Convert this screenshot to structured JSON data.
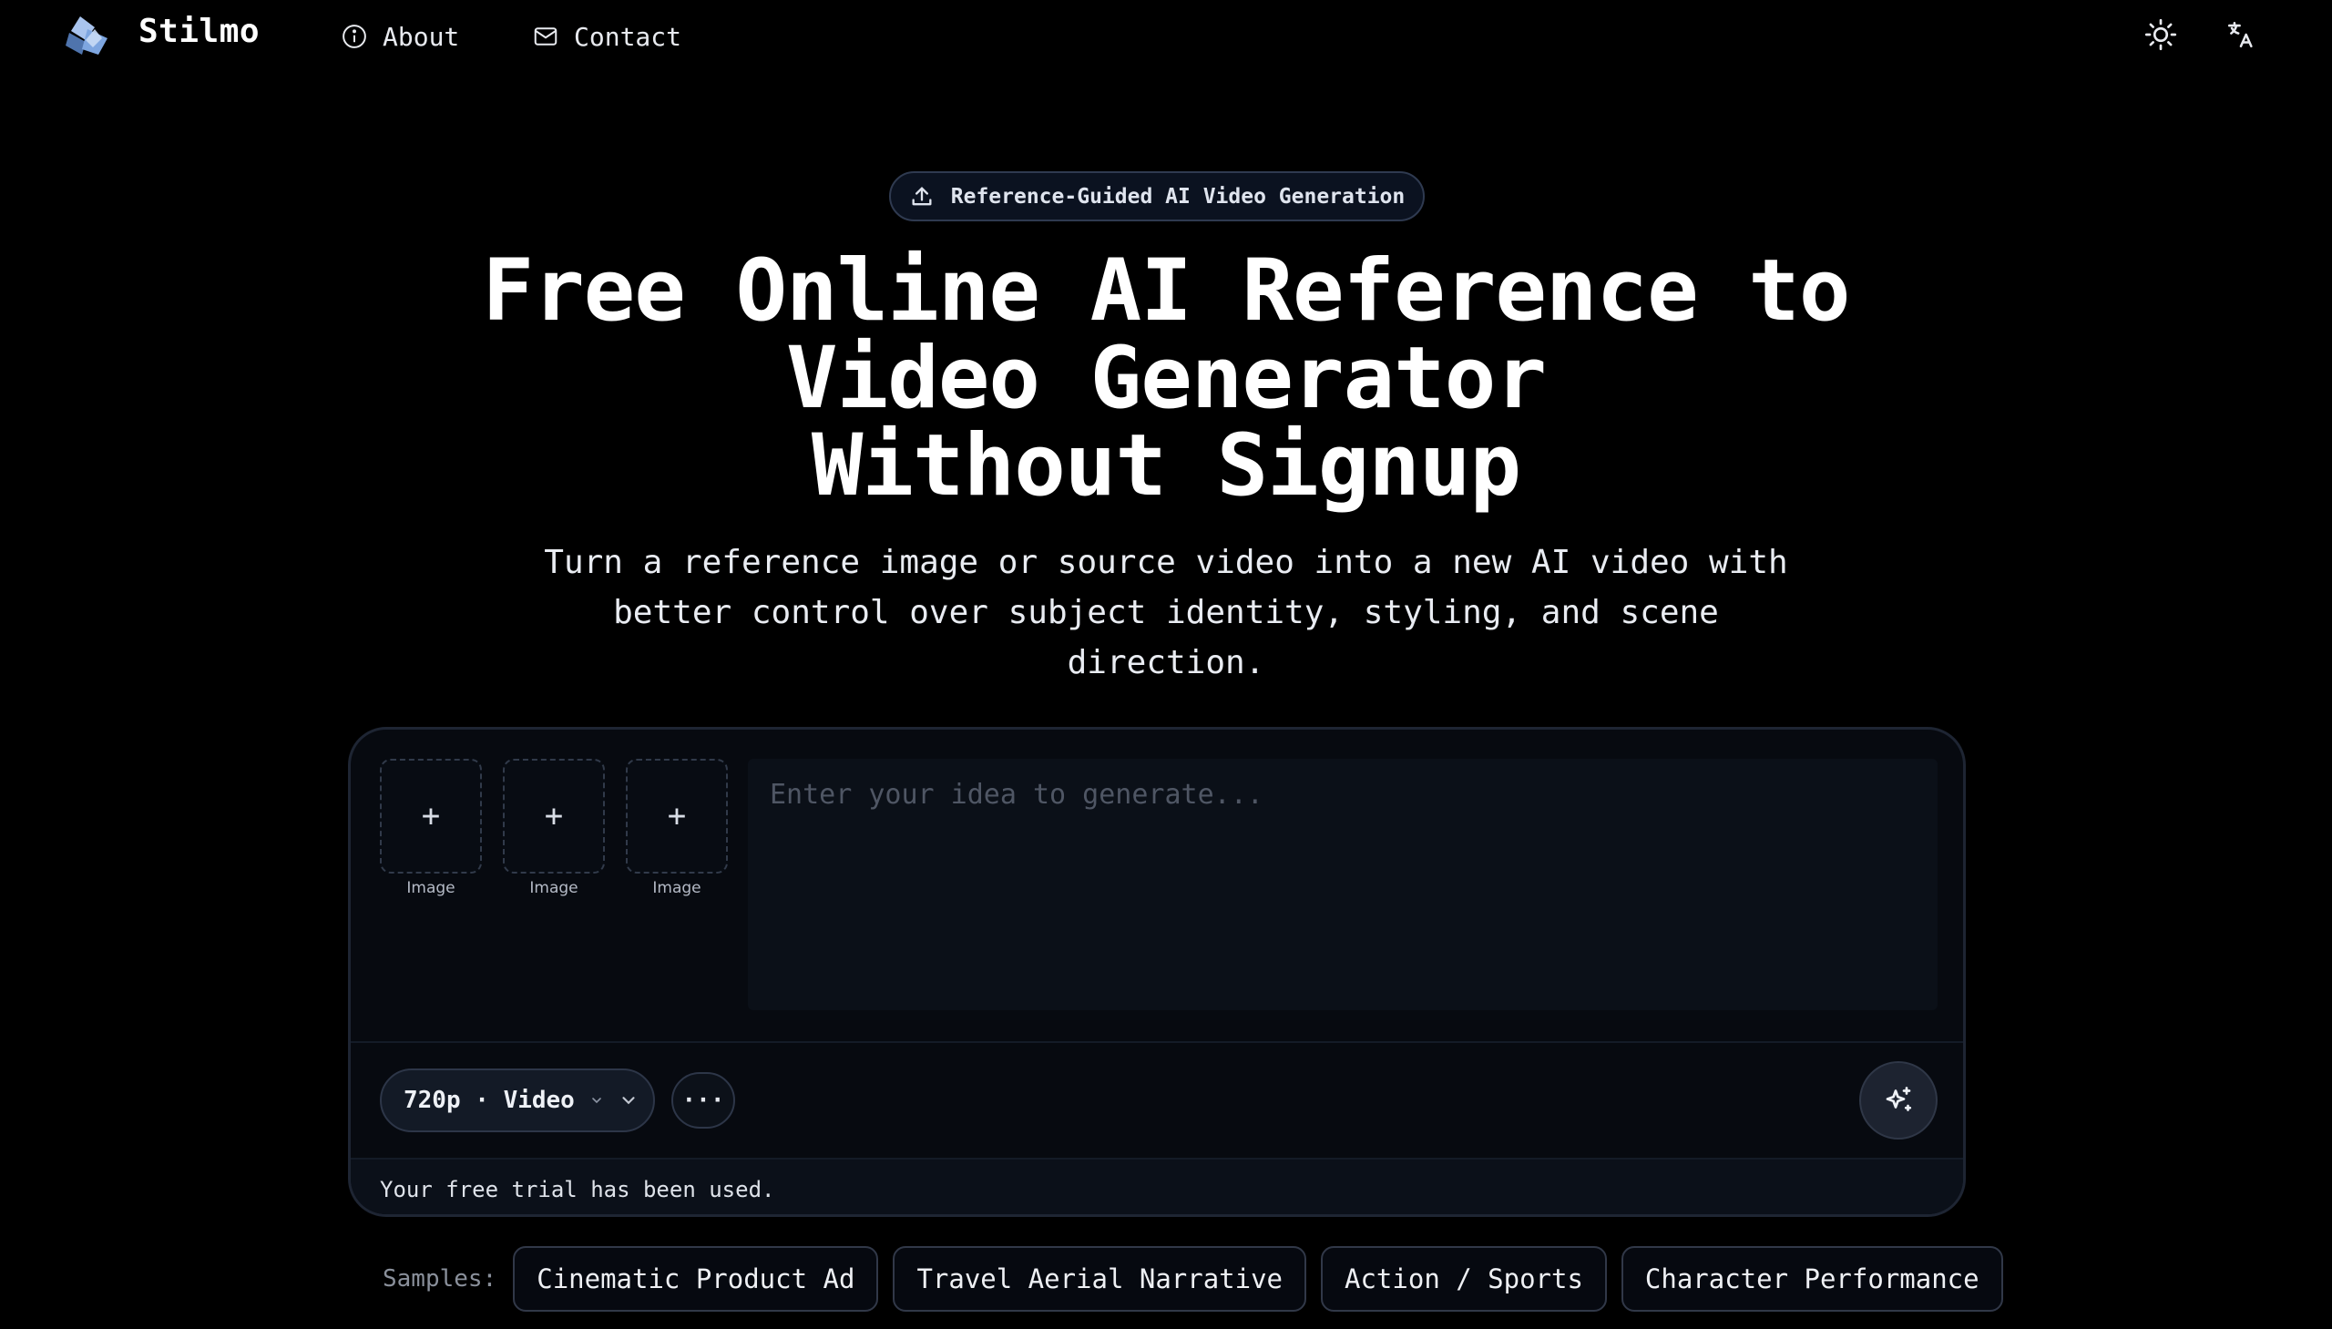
{
  "nav": {
    "brand": "Stilmo",
    "about_label": "About",
    "contact_label": "Contact"
  },
  "hero": {
    "badge": "Reference-Guided AI Video Generation",
    "title_lines": [
      "Free Online AI Reference to",
      "Video Generator",
      "Without Signup"
    ],
    "subtitle": "Turn a reference image or source video into a new AI video with better control over subject identity, styling, and scene direction."
  },
  "composer": {
    "slots": [
      {
        "label": "Image"
      },
      {
        "label": "Image"
      },
      {
        "label": "Image"
      }
    ],
    "prompt_placeholder": "Enter your idea to generate...",
    "prompt_value": "",
    "settings_label": "720p · Video",
    "more_label": "···",
    "status_text": "Your free trial has been used."
  },
  "samples": {
    "label": "Samples:",
    "items": [
      "Cinematic Product Ad",
      "Travel Aerial Narrative",
      "Action / Sports",
      "Character Performance"
    ]
  },
  "colors": {
    "background": "#000000",
    "logo_blue": "#7ea6e0",
    "text": "#f2f4f7"
  },
  "icons": {
    "logo": "stilmo-logo",
    "about": "info-icon",
    "contact": "mail-icon",
    "theme": "sun-icon",
    "language": "translate-icon",
    "badge": "upload-icon",
    "generate": "sparkle-icon"
  }
}
